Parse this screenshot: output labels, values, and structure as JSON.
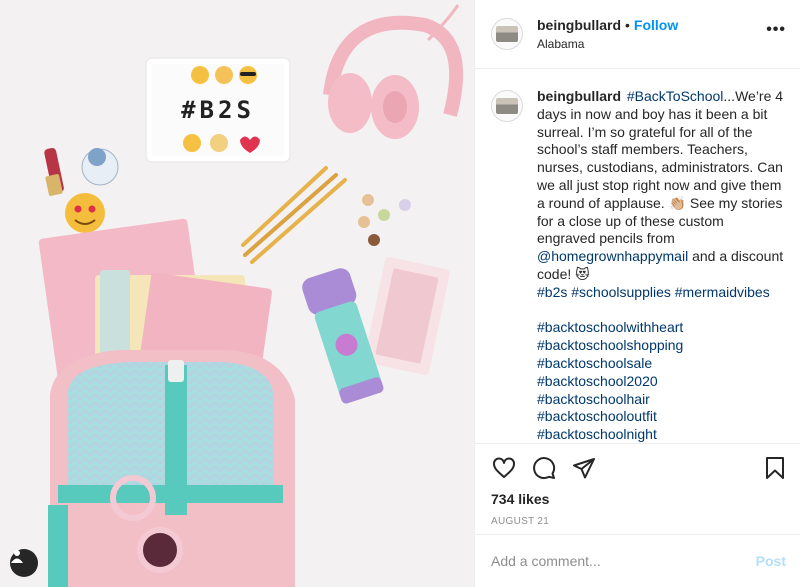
{
  "colors": {
    "accent": "#0095f6",
    "link": "#00376b",
    "muted": "#8e8e8e",
    "post_disabled": "#b2dffc"
  },
  "photo": {
    "lightbox_text": "#B2S",
    "icons": [
      "heart-eyes-emoji",
      "thumbs-up-emoji",
      "sunglasses-emoji",
      "nerd-emoji",
      "raised-hands-emoji",
      "red-heart-emoji"
    ]
  },
  "header": {
    "username": "beingbullard",
    "separator": "•",
    "follow_label": "Follow",
    "location": "Alabama",
    "more_label": "•••"
  },
  "caption": {
    "username": "beingbullard",
    "hashtag_link": "#BackToSchool",
    "text_1": "...We’re 4 days in now and boy has it been a bit surreal. I’m so grateful for all of the school’s staff members. Teachers, nurses, custodians, administrators. Can we all just stop right now and give them a round of applause. 👏🏼 See my stories for a close up of these custom engraved pencils from ",
    "mention": "@homegrownhappymail",
    "text_2": " and a discount code! 😻",
    "tags_line": [
      "#b2s",
      "#schoolsupplies",
      "#mermaidvibes"
    ],
    "tags_list": [
      "#backtoschoolwithheart",
      "#backtoschoolshopping",
      "#backtoschoolsale",
      "#backtoschool2020",
      "#backtoschoolhair",
      "#backtoschooloutfit",
      "#backtoschoolnight"
    ]
  },
  "actions": {
    "likes": "734 likes",
    "date": "AUGUST 21"
  },
  "comment": {
    "placeholder": "Add a comment...",
    "post_label": "Post"
  }
}
